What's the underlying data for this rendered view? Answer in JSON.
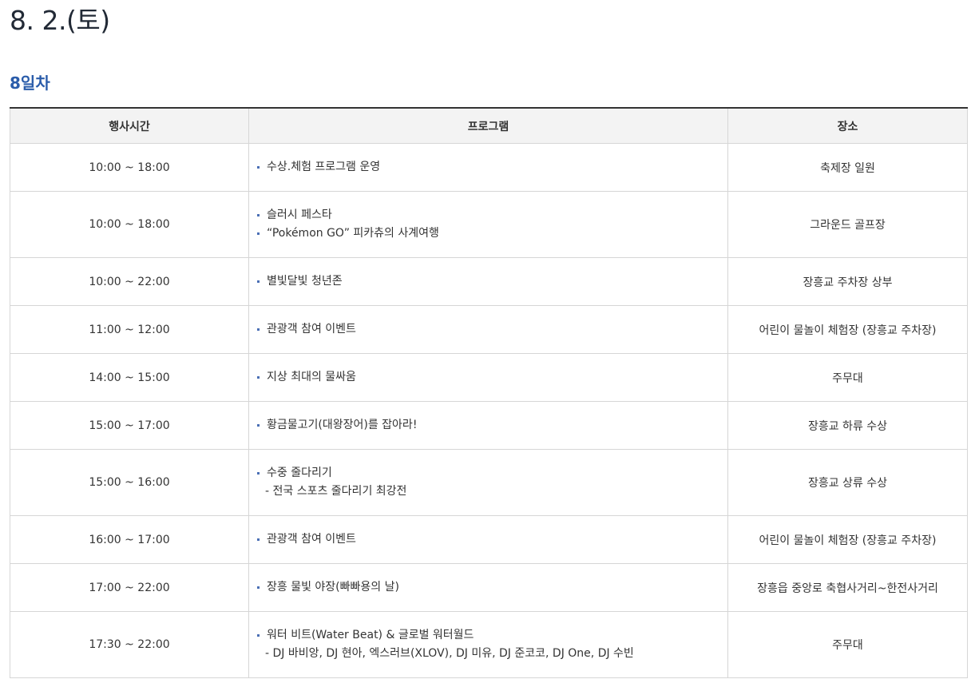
{
  "title": "8. 2.(토)",
  "day_label": "8일차",
  "table": {
    "headers": {
      "time": "행사시간",
      "program": "프로그램",
      "place": "장소"
    },
    "rows": [
      {
        "time": "10:00 ~ 18:00",
        "items": [
          "수상.체험 프로그램 운영"
        ],
        "subs": [],
        "place": "축제장 일원"
      },
      {
        "time": "10:00 ~ 18:00",
        "items": [
          "슬러시 페스타",
          "“Pokémon GO” 피카츄의 사계여행"
        ],
        "subs": [],
        "place": "그라운드 골프장"
      },
      {
        "time": "10:00 ~ 22:00",
        "items": [
          "별빛달빛 청년존"
        ],
        "subs": [],
        "place": "장흥교 주차장 상부"
      },
      {
        "time": "11:00 ~ 12:00",
        "items": [
          "관광객 참여 이벤트"
        ],
        "subs": [],
        "place": "어린이 물놀이 체험장 (장흥교 주차장)"
      },
      {
        "time": "14:00 ~ 15:00",
        "items": [
          "지상 최대의 물싸움"
        ],
        "subs": [],
        "place": "주무대"
      },
      {
        "time": "15:00 ~ 17:00",
        "items": [
          "황금물고기(대왕장어)를 잡아라!"
        ],
        "subs": [],
        "place": "장흥교 하류 수상"
      },
      {
        "time": "15:00 ~ 16:00",
        "items": [
          "수중 줄다리기"
        ],
        "subs": [
          "- 전국 스포츠 줄다리기 최강전"
        ],
        "place": "장흥교 상류 수상"
      },
      {
        "time": "16:00 ~ 17:00",
        "items": [
          "관광객 참여 이벤트"
        ],
        "subs": [],
        "place": "어린이 물놀이 체험장 (장흥교 주차장)"
      },
      {
        "time": "17:00 ~ 22:00",
        "items": [
          "장흥 물빛 야장(빠빠용의 날)"
        ],
        "subs": [],
        "place": "장흥읍 중앙로 축협사거리~한전사거리"
      },
      {
        "time": "17:30 ~ 22:00",
        "items": [
          "워터 비트(Water Beat) & 글로벌 워터월드"
        ],
        "subs": [
          "- DJ 바비앙, DJ 현아, 엑스러브(XLOV), DJ 미유, DJ 준코코, DJ One, DJ 수빈"
        ],
        "place": "주무대"
      }
    ]
  }
}
